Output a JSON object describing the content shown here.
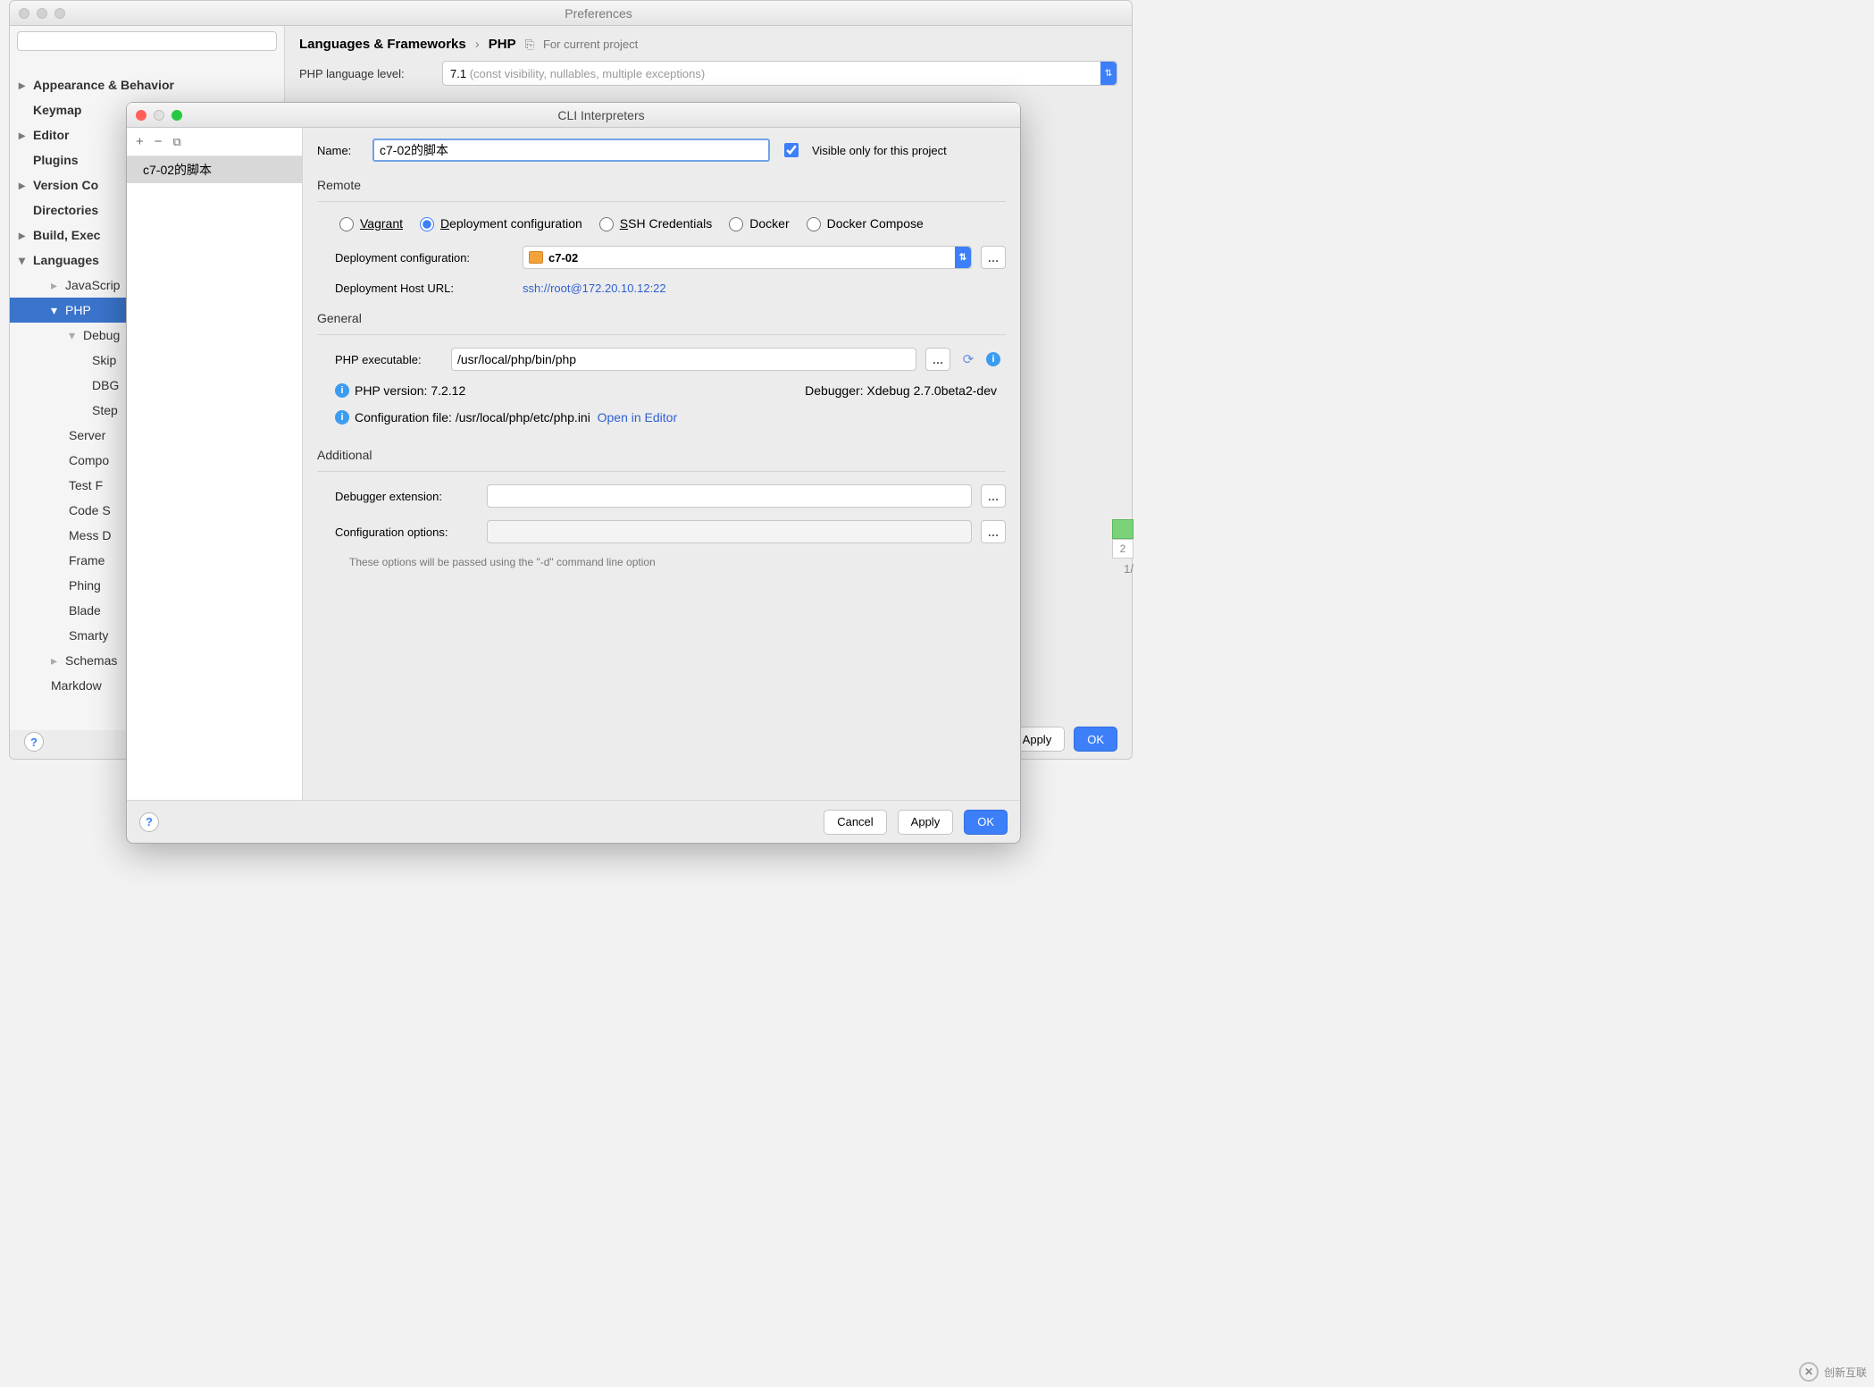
{
  "prefs": {
    "title": "Preferences",
    "breadcrumb": {
      "main": "Languages & Frameworks",
      "sep": "›",
      "sub": "PHP",
      "scope_label": "For current project"
    },
    "php_level": {
      "label": "PHP language level:",
      "value": "7.1",
      "hint": "(const visibility, nullables, multiple exceptions)"
    },
    "footer": {
      "apply": "Apply",
      "ok": "OK"
    },
    "side_number_top": "2",
    "side_number_bottom": "1/",
    "tree": {
      "appearance": "Appearance & Behavior",
      "keymap": "Keymap",
      "editor": "Editor",
      "plugins": "Plugins",
      "version": "Version Co",
      "directories": "Directories",
      "build": "Build, Exec",
      "languages": "Languages",
      "javascript": "JavaScrip",
      "php": "PHP",
      "debug": "Debug",
      "skip": "Skip",
      "dbg": "DBG",
      "step": "Step",
      "servers": "Server",
      "composer": "Compo",
      "testf": "Test F",
      "codes": "Code S",
      "mess": "Mess D",
      "frame": "Frame",
      "phing": "Phing",
      "blade": "Blade",
      "smarty": "Smarty",
      "schemas": "Schemas",
      "markdown": "Markdow"
    }
  },
  "cli": {
    "title": "CLI Interpreters",
    "list": {
      "item0": "c7-02的脚本"
    },
    "name_label": "Name:",
    "name_value": "c7-02的脚本",
    "visible_label": "Visible only for this project",
    "remote": {
      "title": "Remote",
      "vagrant": "Vagrant",
      "deploy": "Deployment configuration",
      "ssh": "SSH Credentials",
      "docker": "Docker",
      "compose": "Docker Compose",
      "deploy_conf_label": "Deployment configuration:",
      "deploy_conf_value": "c7-02",
      "host_label": "Deployment Host URL:",
      "host_value": "ssh://root@172.20.10.12:22"
    },
    "general": {
      "title": "General",
      "exec_label": "PHP executable:",
      "exec_value": "/usr/local/php/bin/php",
      "version_label": "PHP version: 7.2.12",
      "debugger_label": "Debugger: Xdebug 2.7.0beta2-dev",
      "conf_file_label": "Configuration file: /usr/local/php/etc/php.ini",
      "open_editor": "Open in Editor"
    },
    "additional": {
      "title": "Additional",
      "dbg_ext_label": "Debugger extension:",
      "conf_opt_label": "Configuration options:",
      "note": "These options will be passed using the \"-d\" command line option"
    },
    "footer": {
      "cancel": "Cancel",
      "apply": "Apply",
      "ok": "OK"
    }
  },
  "watermark": "创新互联"
}
